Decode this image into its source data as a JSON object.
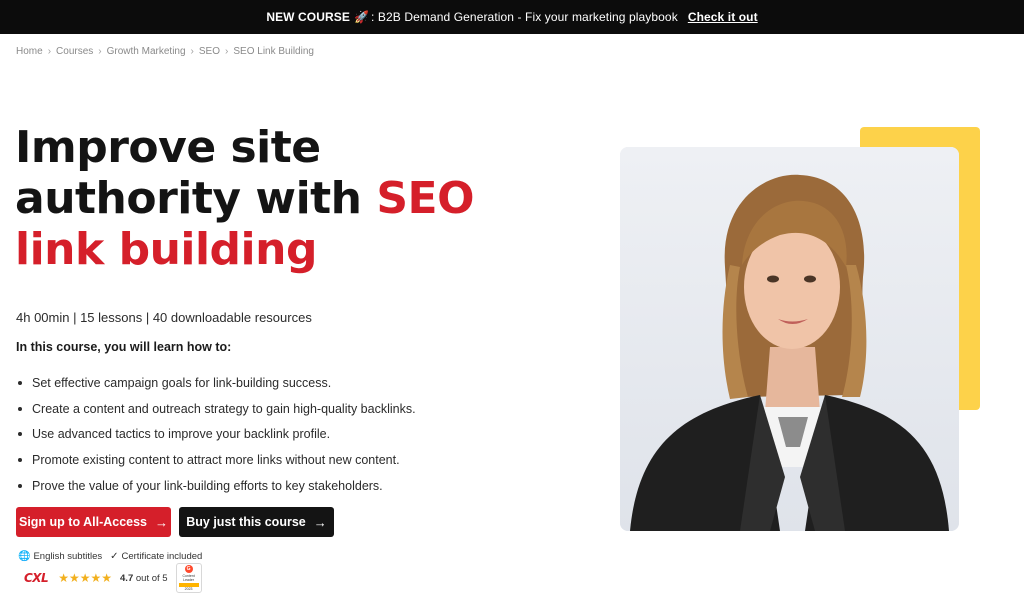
{
  "announcement": {
    "label": "NEW COURSE",
    "emoji": "🚀",
    "text": ": B2B Demand Generation - Fix your marketing playbook",
    "cta": "Check it out"
  },
  "breadcrumb": [
    "Home",
    "Courses",
    "Growth Marketing",
    "SEO",
    "SEO Link Building"
  ],
  "hero": {
    "title_line1": "Improve site",
    "title_line2_plain": "authority with ",
    "title_line2_red": "SEO",
    "title_line3_red": "link building"
  },
  "course_meta": "4h 00min | 15 lessons | 40 downloadable resources",
  "learn_heading": "In this course, you will learn how to:",
  "learn_items": [
    "Set effective campaign goals for link-building success.",
    "Create a content and outreach strategy to gain high-quality backlinks.",
    "Use advanced tactics to improve your backlink profile.",
    "Promote existing content to attract more links without new content.",
    "Prove the value of your link-building efforts to key stakeholders."
  ],
  "buttons": {
    "primary": "Sign up to All-Access",
    "secondary": "Buy just this course"
  },
  "features": {
    "subtitles": "English subtitles",
    "certificate": "Certificate included"
  },
  "rating": {
    "brand": "CXL",
    "stars": "★★★★★",
    "score": "4.7",
    "out_of": "out of 5",
    "rating_value": 4.7,
    "badge_lines": [
      "Content",
      "Leader",
      "2023"
    ]
  },
  "colors": {
    "accent_red": "#d51f2a",
    "dark": "#141414",
    "yellow": "#fdd24a"
  }
}
